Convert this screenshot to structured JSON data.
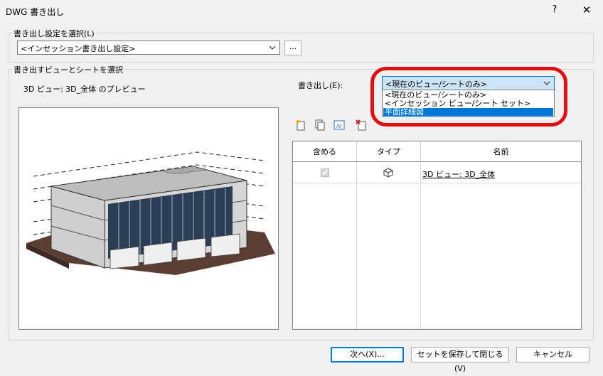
{
  "window": {
    "title": "DWG 書き出し",
    "help_glyph": "?",
    "close_glyph": "✕"
  },
  "export_settings": {
    "group_label": "書き出し設定を選択(L)",
    "value": "<インセッション書き出し設定>",
    "browse_label": "..."
  },
  "views_sheets": {
    "group_label": "書き出すビューとシートを選択",
    "preview_label": "3D ビュー: 3D_全体 のプレビュー",
    "export_label": "書き出し(E):",
    "export_value": "<現在のビュー/シートのみ>",
    "export_options": [
      "<現在のビュー/シートのみ>",
      "<インセッション ビュー/シート セット>",
      "平面詳細図"
    ],
    "export_selected_index": 2,
    "tools": [
      "new-set-icon",
      "duplicate-set-icon",
      "rename-set-icon",
      "delete-set-icon"
    ],
    "table": {
      "headers": [
        "含める",
        "タイプ",
        "名前"
      ],
      "rows": [
        {
          "include": true,
          "type_icon": "3d-view-icon",
          "name": "3D ビュー: 3D_全体"
        }
      ]
    }
  },
  "footer": {
    "next_label": "次へ(X)...",
    "save_close_label": "セットを保存して閉じる(V)",
    "cancel_label": "キャンセル"
  },
  "colors": {
    "highlight": "#0078d7",
    "annotation_circle": "#e01010",
    "dialog_bg": "#f0f0f0"
  }
}
